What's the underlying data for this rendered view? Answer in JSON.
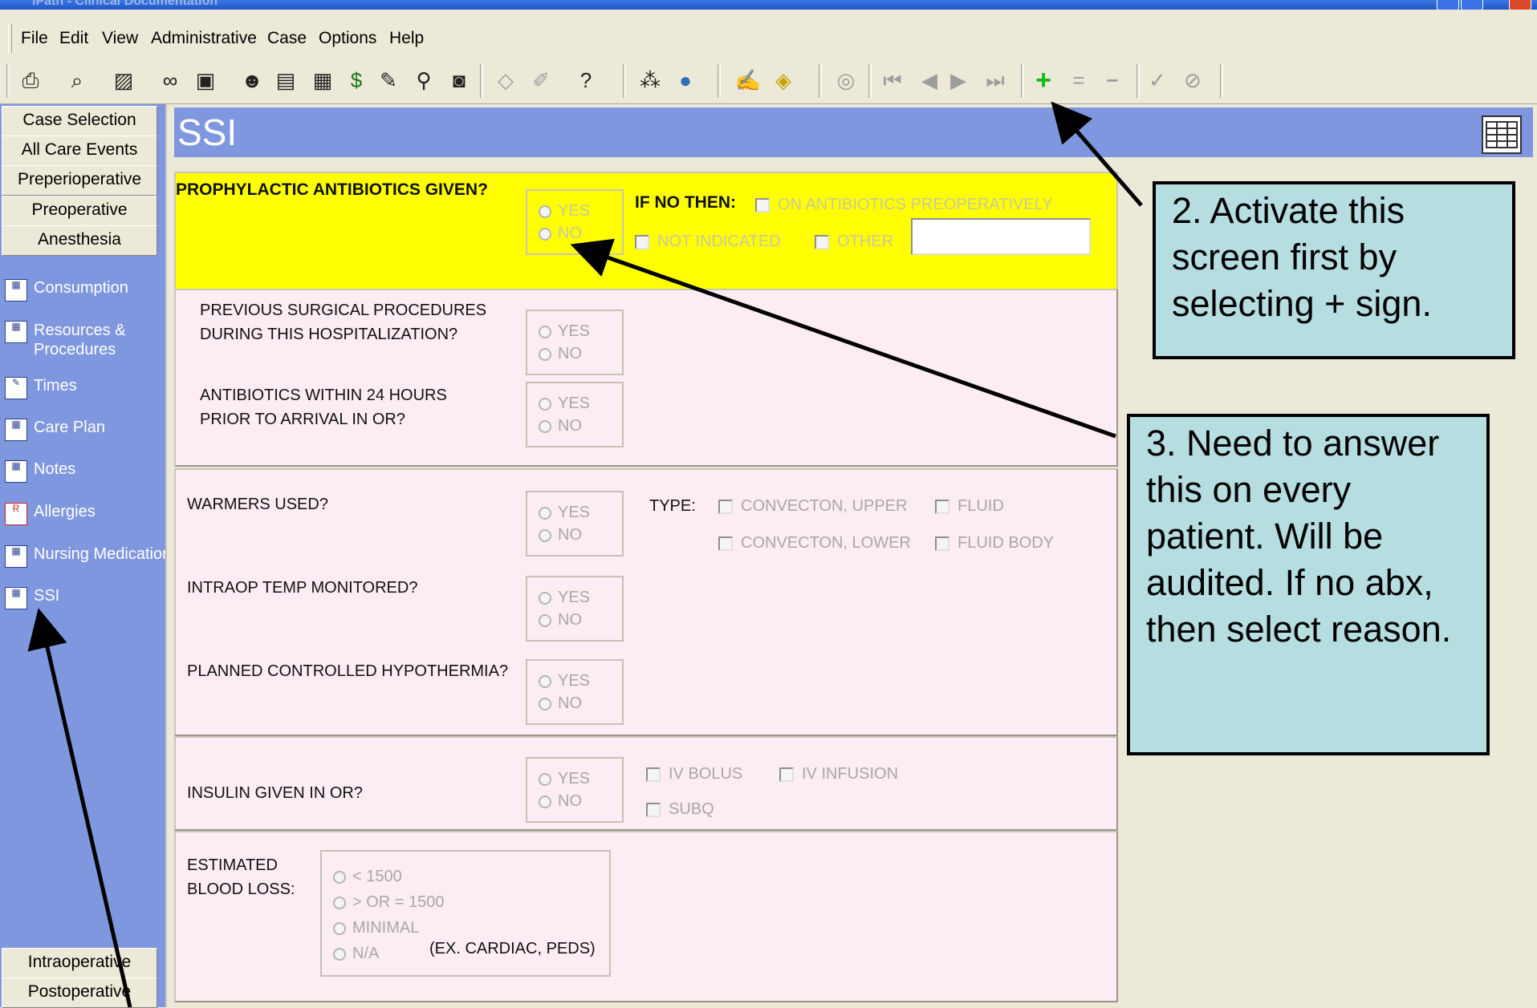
{
  "window": {
    "title": "iPath - Clinical Documentation"
  },
  "menu": [
    "File",
    "Edit",
    "View",
    "Administrative",
    "Case",
    "Options",
    "Help"
  ],
  "toolbar_icons": [
    "printer-icon",
    "preview-icon",
    "report-icon",
    "glasses-icon",
    "search-doc-icon",
    "head-icon",
    "calculator-icon",
    "ledger-icon",
    "dollar-icon",
    "pen-icon",
    "lookup-icon",
    "camera-icon",
    "eraser-icon",
    "brush-icon",
    "help-icon",
    "wand-icon",
    "globe-icon",
    "signature-icon",
    "note-icon",
    "find-icon",
    "first-record-icon",
    "prev-record-icon",
    "next-record-icon",
    "last-record-icon",
    "add-icon",
    "equals-icon",
    "minus-icon",
    "check-icon",
    "cancel-icon"
  ],
  "nav": {
    "top_buttons": [
      "Case Selection",
      "All Care Events",
      "Preperioperative",
      "Preoperative",
      "Anesthesia"
    ],
    "links": [
      "Consumption",
      "Resources & Procedures",
      "Times",
      "Care Plan",
      "Notes",
      "Allergies",
      "Nursing Medication",
      "SSI"
    ],
    "bottom_buttons": [
      "Intraoperative",
      "Postoperative"
    ]
  },
  "screen": {
    "title": "SSI",
    "prophylactic": {
      "question": "PROPHYLACTIC ANTIBIOTICS GIVEN?",
      "if_no": "IF NO THEN:",
      "opt_preop": "ON ANTIBIOTICS PREOPERATIVELY",
      "opt_not_indicated": "NOT INDICATED",
      "opt_other": "OTHER",
      "other_value": ""
    },
    "yes": "YES",
    "no": "NO",
    "previous_surgical": "PREVIOUS SURGICAL PROCEDURES DURING THIS HOSPITALIZATION?",
    "antibiotics_24": "ANTIBIOTICS WITHIN 24 HOURS PRIOR TO ARRIVAL IN OR?",
    "warmers": "WARMERS USED?",
    "type": "TYPE:",
    "convecton_upper": "CONVECTON, UPPER",
    "convecton_lower": "CONVECTON, LOWER",
    "fluid": "FLUID",
    "fluid_body": "FLUID BODY",
    "intraop_temp": "INTRAOP TEMP MONITORED?",
    "hypothermia": "PLANNED CONTROLLED HYPOTHERMIA?",
    "insulin": "INSULIN GIVEN IN OR?",
    "iv_bolus": "IV BOLUS",
    "iv_infusion": "IV INFUSION",
    "subq": "SUBQ",
    "blood_loss_label": "ESTIMATED BLOOD LOSS:",
    "blood_loss_options": [
      "< 1500",
      "> OR = 1500",
      "MINIMAL",
      "N/A"
    ],
    "blood_loss_note": "(EX. CARDIAC, PEDS)"
  },
  "callouts": {
    "two": "2. Activate this screen first by selecting + sign.",
    "three": "3. Need to answer this on every patient. Will be audited. If no abx, then select reason."
  },
  "colors": {
    "nav_blue": "#7f97df",
    "panel_pink": "#fcecf3",
    "highlight_yellow": "#ffff00",
    "callout_fill": "#b6dde0"
  }
}
